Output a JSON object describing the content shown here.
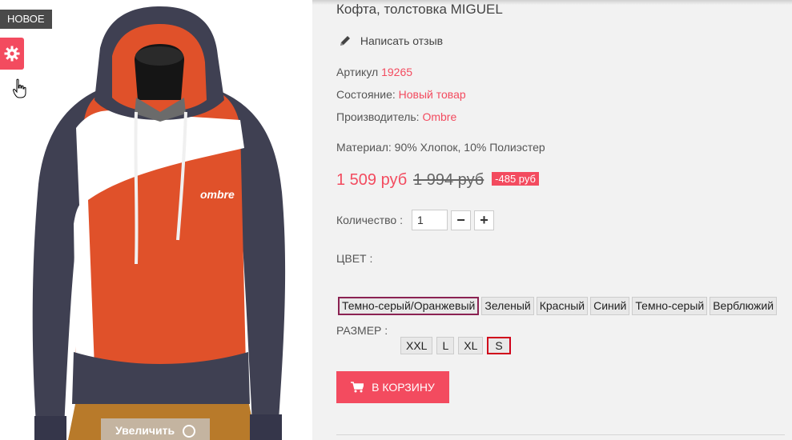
{
  "badge": {
    "new_label": "НОВОЕ"
  },
  "gallery": {
    "zoom_label": "Увеличить"
  },
  "product": {
    "title": "Кофта, толстовка MIGUEL",
    "review_link": "Написать отзыв",
    "article_label": "Артикул",
    "article_value": "19265",
    "condition_label": "Состояние:",
    "condition_value": "Новый товар",
    "maker_label": "Производитель:",
    "maker_value": "Ombre",
    "material": "Материал: 90% Хлопок, 10% Полиэстер",
    "price": "1 509 руб",
    "old_price": "1 994 руб",
    "discount": "-485 руб"
  },
  "quantity": {
    "label": "Количество :",
    "value": "1",
    "minus": "−",
    "plus": "+"
  },
  "color": {
    "label": "ЦВЕТ :",
    "options": [
      "Темно-серый/Оранжевый",
      "Зеленый",
      "Красный",
      "Синий",
      "Темно-серый",
      "Верблюжий"
    ],
    "selected": "Темно-серый/Оранжевый"
  },
  "size": {
    "label": "РАЗМЕР :",
    "options": [
      "XXL",
      "L",
      "XL",
      "S"
    ],
    "selected": "S"
  },
  "cart": {
    "label": "В КОРЗИНУ"
  },
  "icons": {
    "settings": "gear-icon",
    "cursor": "hand-pointer-icon",
    "review": "pencil-icon",
    "cart": "shopping-cart-icon",
    "zoom": "plus-circle-icon"
  },
  "colors": {
    "accent": "#f34b5f",
    "badge": "#4a4a4a",
    "background": "#f2f2f2"
  }
}
